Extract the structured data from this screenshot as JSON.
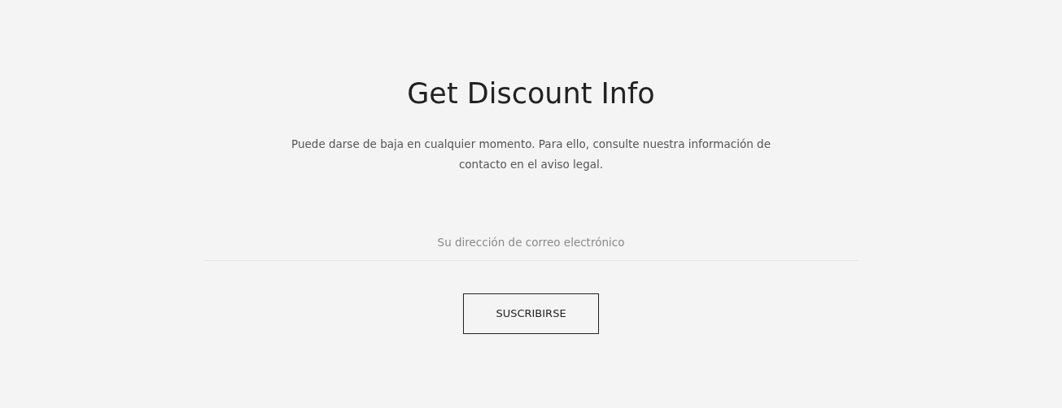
{
  "title": "Get Discount Info",
  "description": "Puede darse de baja en cualquier momento. Para ello, consulte nuestra información de contacto en el aviso legal.",
  "email_field": {
    "placeholder": "Su dirección de correo electrónico"
  },
  "submit_button": {
    "label": "SUSCRIBIRSE"
  }
}
